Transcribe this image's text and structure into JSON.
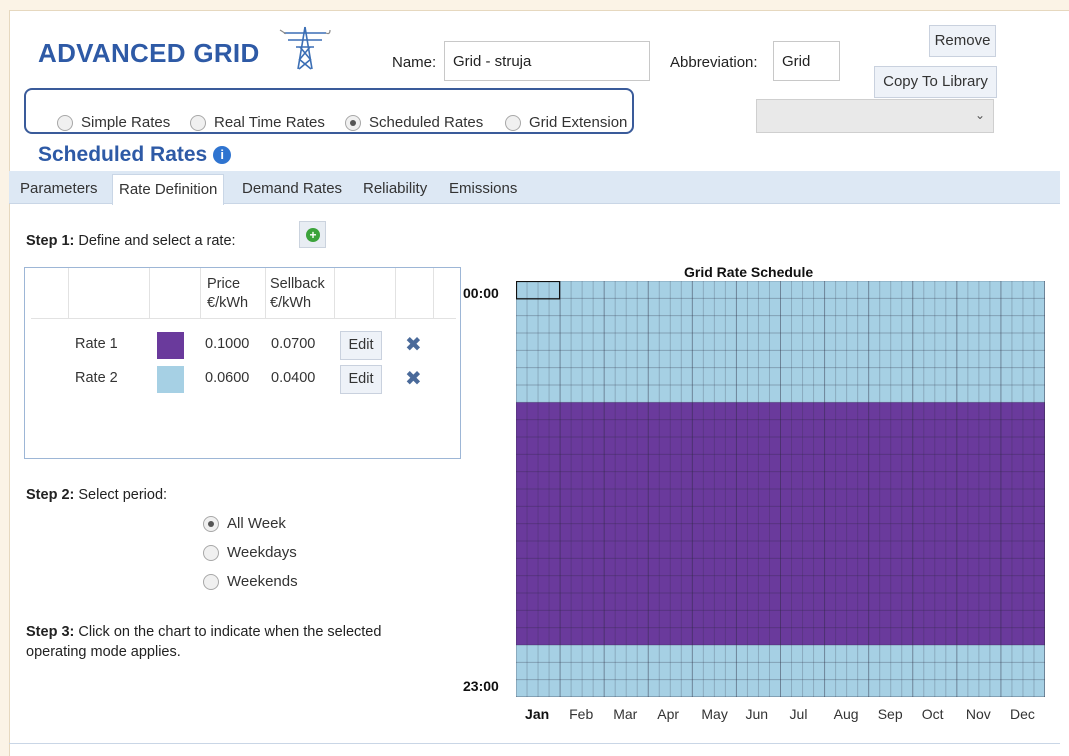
{
  "header": {
    "title": "ADVANCED GRID",
    "name_label": "Name:",
    "name_value": "Grid - struja",
    "abbrev_label": "Abbreviation:",
    "abbrev_value": "Grid",
    "remove_label": "Remove",
    "copy_label": "Copy To Library",
    "dropdown_value": ""
  },
  "rate_modes": [
    {
      "label": "Simple Rates",
      "checked": false
    },
    {
      "label": "Real Time Rates",
      "checked": false
    },
    {
      "label": "Scheduled Rates",
      "checked": true
    },
    {
      "label": "Grid Extension",
      "checked": false
    }
  ],
  "section_title": "Scheduled Rates",
  "tabs": [
    {
      "label": "Parameters",
      "active": false
    },
    {
      "label": "Rate Definition",
      "active": true
    },
    {
      "label": "Demand Rates",
      "active": false
    },
    {
      "label": "Reliability",
      "active": false
    },
    {
      "label": "Emissions",
      "active": false
    }
  ],
  "step1": {
    "bold": "Step 1:",
    "text": " Define and select a rate:"
  },
  "table": {
    "col_price": [
      "Price",
      "€/kWh"
    ],
    "col_sellback": [
      "Sellback",
      "€/kWh"
    ],
    "edit_label": "Edit",
    "rows": [
      {
        "name": "Rate 1",
        "color": "#6a3a9c",
        "price": "0.1000",
        "sellback": "0.0700"
      },
      {
        "name": "Rate 2",
        "color": "#a6d0e4",
        "price": "0.0600",
        "sellback": "0.0400"
      }
    ]
  },
  "step2": {
    "bold": "Step 2:",
    "text": " Select period:"
  },
  "periods": [
    {
      "label": "All Week",
      "checked": true
    },
    {
      "label": "Weekdays",
      "checked": false
    },
    {
      "label": "Weekends",
      "checked": false
    }
  ],
  "step3": {
    "bold": "Step 3:",
    "line1": " Click on the chart to indicate when the selected",
    "line2": "operating mode applies."
  },
  "schedule": {
    "title": "Grid Rate Schedule",
    "y_top_label": "00:00",
    "y_bottom_label": "23:00",
    "months": [
      "Jan",
      "Feb",
      "Mar",
      "Apr",
      "May",
      "Jun",
      "Jul",
      "Aug",
      "Sep",
      "Oct",
      "Nov",
      "Dec"
    ],
    "selected_month": "Jan",
    "hours": 24,
    "rate1_hours": {
      "start": 7,
      "end": 20
    },
    "rate1_color": "#6a3a9c",
    "rate2_color": "#a6d0e4"
  }
}
